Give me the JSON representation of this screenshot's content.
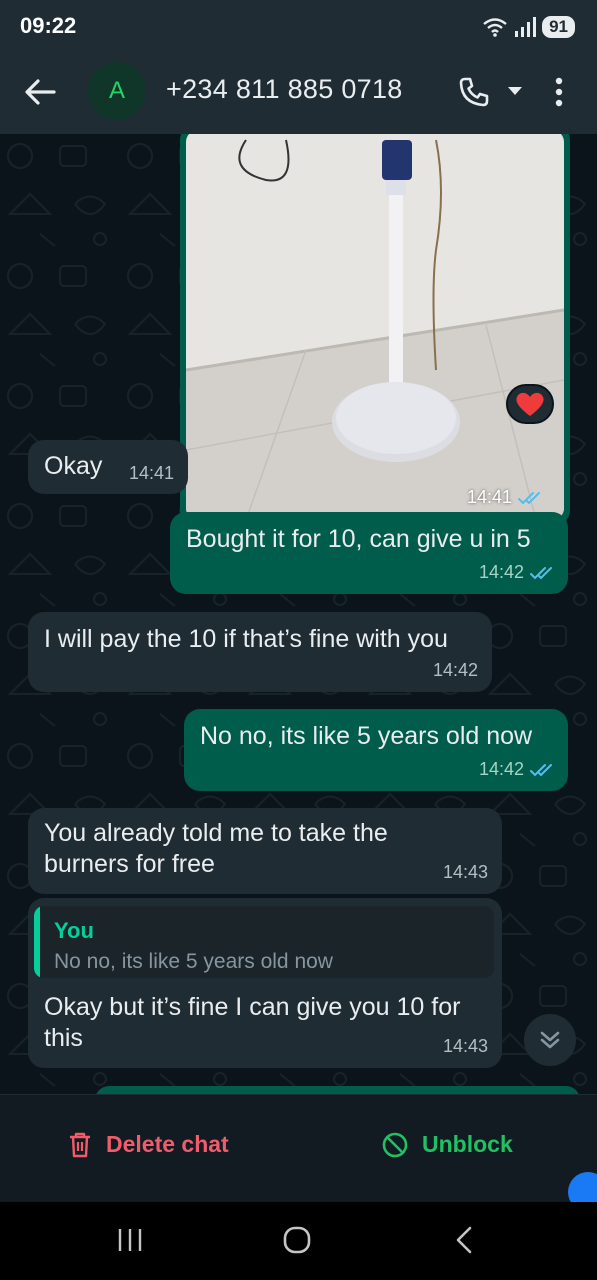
{
  "status_bar": {
    "time": "09:22",
    "battery": "91"
  },
  "header": {
    "avatar_letter": "A",
    "contact": "+234 811 885 0718"
  },
  "messages": [
    {
      "id": "image",
      "direction": "outgoing",
      "type": "image",
      "time": "14:41",
      "read": true,
      "reaction": "❤️"
    },
    {
      "id": "m1",
      "direction": "incoming",
      "text": "Okay",
      "time": "14:41"
    },
    {
      "id": "m2",
      "direction": "outgoing",
      "text": "Bought it for 10, can give u in 5",
      "time": "14:42",
      "read": true
    },
    {
      "id": "m3",
      "direction": "incoming",
      "text": "I will pay the 10 if that’s fine with you",
      "time": "14:42"
    },
    {
      "id": "m4",
      "direction": "outgoing",
      "text": "No no, its like 5 years old now",
      "time": "14:42",
      "read": true
    },
    {
      "id": "m5",
      "direction": "incoming",
      "text": "You already told me to take the\nburners for free",
      "time": "14:43"
    },
    {
      "id": "m6",
      "direction": "incoming",
      "quote": {
        "author": "You",
        "text": "No no, its like 5 years old now"
      },
      "text": "Okay but it’s fine I can give you 10 for\nthis",
      "time": "14:43"
    }
  ],
  "actions": {
    "delete": "Delete chat",
    "unblock": "Unblock"
  },
  "colors": {
    "accent_green": "#21c063",
    "danger_red": "#f15c6d",
    "outgoing_bubble": "#005c4b",
    "incoming_bubble": "#202c33",
    "read_ticks": "#53bdeb"
  },
  "icons": [
    "back-arrow-icon",
    "phone-icon",
    "chevron-down-icon",
    "more-vert-icon",
    "double-check-icon",
    "heart-icon",
    "chevrons-down-icon",
    "trash-icon",
    "block-icon",
    "recents-icon",
    "home-icon",
    "back-nav-icon"
  ]
}
